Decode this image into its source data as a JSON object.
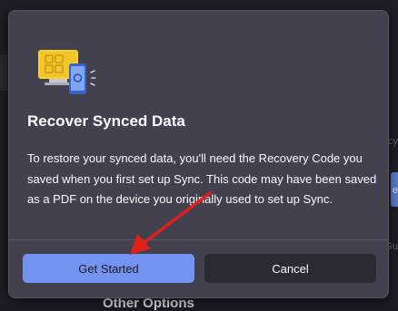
{
  "background": {
    "right_fragment_1": "cy",
    "right_fragment_2": "e",
    "right_fragment_3": "Gu",
    "bottom_text": "Other Options"
  },
  "dialog": {
    "title": "Recover Synced Data",
    "body": "To restore your synced data, you'll need the Recovery Code you saved when you first set up Sync. This code may have been saved as a PDF on the device you originally used to set up Sync.",
    "primary_button": "Get Started",
    "secondary_button": "Cancel"
  },
  "colors": {
    "dialog_bg": "#42414d",
    "primary_accent": "#7393f1",
    "annotation_arrow": "#e0201b"
  },
  "icons": {
    "illustration": "monitor-and-phone-sync-illustration"
  }
}
